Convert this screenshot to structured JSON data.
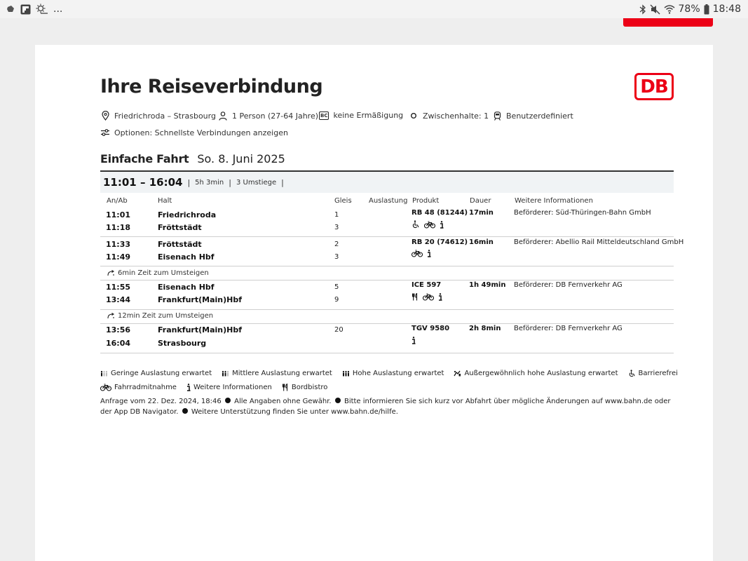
{
  "status_bar": {
    "more": "...",
    "battery": "78%",
    "time": "18:48"
  },
  "title": "Ihre Reiseverbindung",
  "logo": "DB",
  "meta": {
    "route": "Friedrichroda – Strasbourg",
    "travellers": "1 Person (27-64 Jahre)",
    "bahncard_badge": "BC",
    "discount": "keine Ermäßigung",
    "stops": "Zwischenhalte: 1",
    "profile": "Benutzerdefiniert",
    "options": "Optionen: Schnellste Verbindungen anzeigen"
  },
  "trip": {
    "type": "Einfache Fahrt",
    "date": "So. 8. Juni 2025"
  },
  "connection": {
    "time": "11:01 – 16:04",
    "sep": "|",
    "duration": "5h 3min",
    "transfers": "3 Umstiege"
  },
  "columns": [
    "An/Ab",
    "Halt",
    "Gleis",
    "Auslastung",
    "Produkt",
    "Dauer",
    "Weitere Informationen"
  ],
  "legs": [
    {
      "dep_time": "11:01",
      "dep_stop": "Friedrichroda",
      "dep_track": "1",
      "arr_time": "11:18",
      "arr_stop": "Fröttstädt",
      "arr_track": "3",
      "product": "RB 48 (81244)",
      "duration": "17min",
      "info": "Beförderer: Süd-Thüringen-Bahn GmbH",
      "icons": [
        "wheelchair-icon",
        "bicycle-icon",
        "info-icon"
      ]
    },
    {
      "dep_time": "11:33",
      "dep_stop": "Fröttstädt",
      "dep_track": "2",
      "arr_time": "11:49",
      "arr_stop": "Eisenach Hbf",
      "arr_track": "3",
      "product": "RB 20 (74612)",
      "duration": "16min",
      "info": "Beförderer: Abellio Rail Mitteldeutschland GmbH",
      "icons": [
        "bicycle-icon",
        "info-icon"
      ]
    },
    {
      "dep_time": "11:55",
      "dep_stop": "Eisenach Hbf",
      "dep_track": "5",
      "arr_time": "13:44",
      "arr_stop": "Frankfurt(Main)Hbf",
      "arr_track": "9",
      "product": "ICE 597",
      "duration": "1h 49min",
      "info": "Beförderer: DB Fernverkehr AG",
      "icons": [
        "bistro-icon",
        "bicycle-icon",
        "info-icon"
      ]
    },
    {
      "dep_time": "13:56",
      "dep_stop": "Frankfurt(Main)Hbf",
      "dep_track": "20",
      "arr_time": "16:04",
      "arr_stop": "Strasbourg",
      "arr_track": "",
      "product": "TGV 9580",
      "duration": "2h 8min",
      "info": "Beförderer: DB Fernverkehr AG",
      "icons": [
        "info-icon"
      ]
    }
  ],
  "transfers": [
    "6min Zeit zum Umsteigen",
    "12min Zeit zum Umsteigen"
  ],
  "legend": {
    "low": "Geringe Auslastung erwartet",
    "medium": "Mittlere Auslastung erwartet",
    "high": "Hohe Auslastung erwartet",
    "very_high": "Außergewöhnlich hohe Auslastung erwartet",
    "accessible": "Barrierefrei",
    "bike": "Fahrradmitnahme",
    "info": "Weitere Informationen",
    "bistro": "Bordbistro"
  },
  "footnote": {
    "part1": "Anfrage vom 22. Dez. 2024, 18:46",
    "part2": "Alle Angaben ohne Gewähr.",
    "part3": "Bitte informieren Sie sich kurz vor Abfahrt über mögliche Änderungen auf www.bahn.de oder der App DB Navigator.",
    "part4": "Weitere Unterstützung finden Sie unter www.bahn.de/hilfe."
  },
  "colors": {
    "db_red": "#ec0016",
    "row_header_bg": "#f0f3f5"
  }
}
